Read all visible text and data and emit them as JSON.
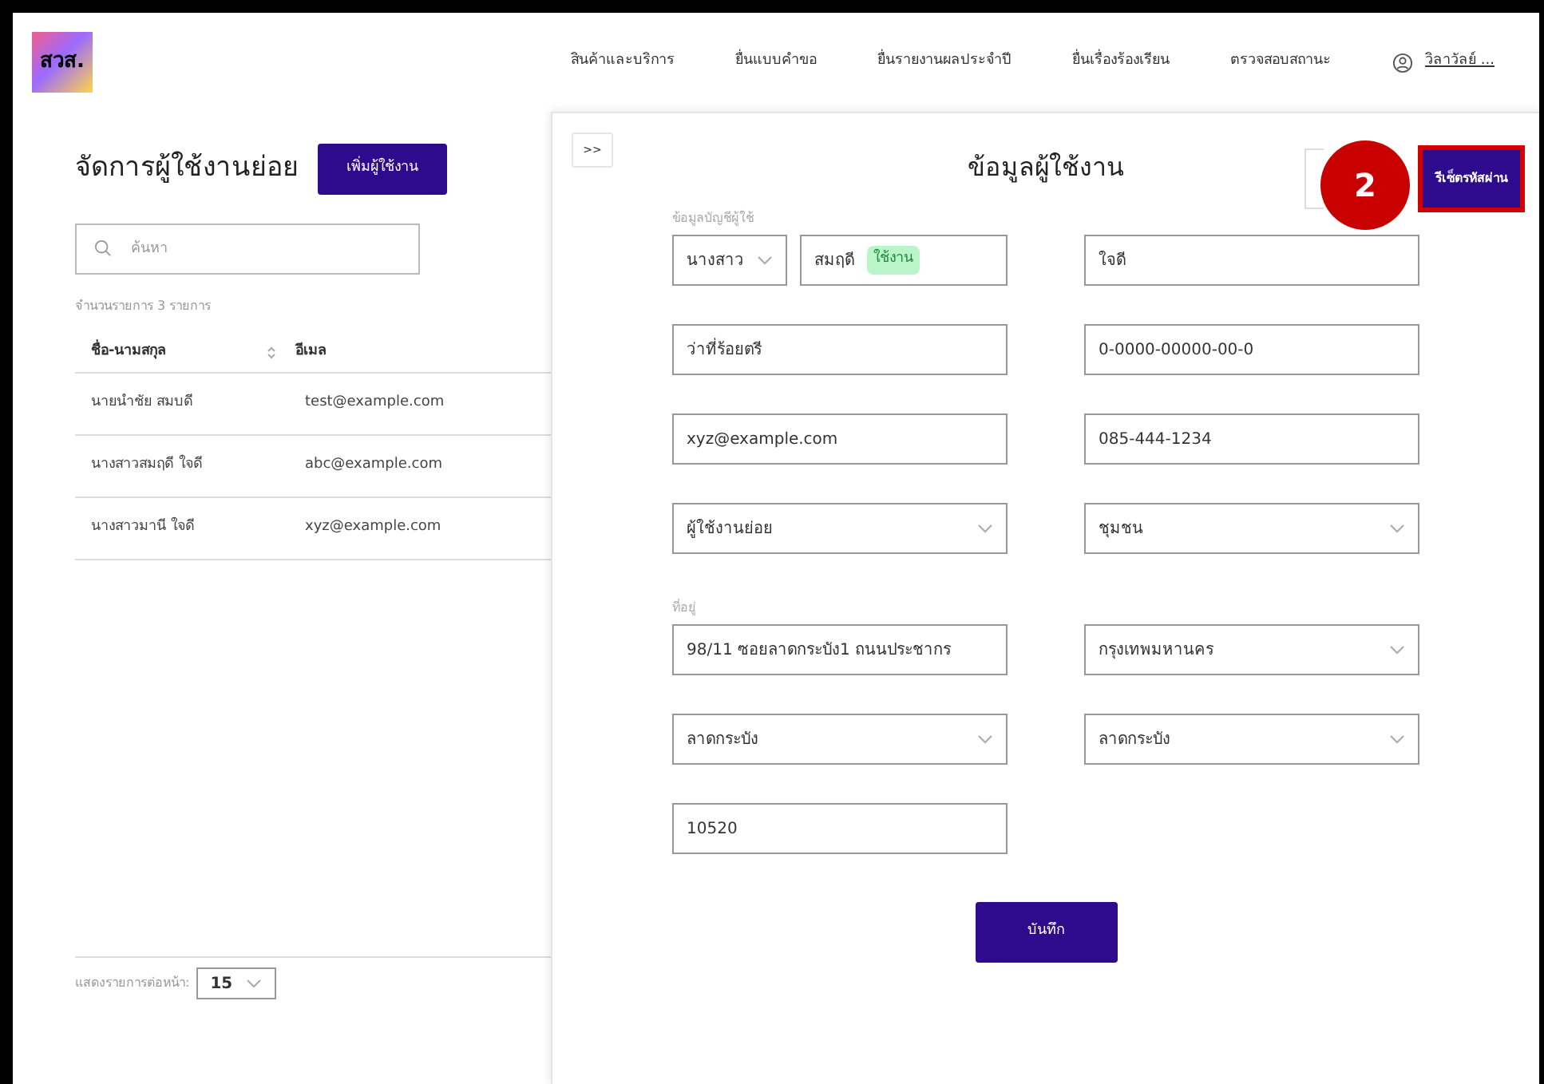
{
  "header": {
    "logo": "สวส.",
    "nav": [
      "สินค้าและบริการ",
      "ยื่นแบบคำขอ",
      "ยื่นรายงานผลประจำปี",
      "ยื่นเรื่องร้องเรียน",
      "ตรวจสอบสถานะ"
    ],
    "user": "วิลาวัลย์ ..."
  },
  "list_panel": {
    "title": "จัดการผู้ใช้งานย่อย",
    "add_button": "เพิ่มผู้ใช้งาน",
    "search": {
      "placeholder": "ค้นหา"
    },
    "count": "จำนวนรายการ 3 รายการ",
    "columns": [
      "ชื่อ-นามสกุล",
      "อีเมล"
    ],
    "rows": [
      {
        "name": "นายนำชัย สมบดี",
        "email": "test@example.com",
        "selected": false
      },
      {
        "name": "นางสาวสมฤดี ใจดี",
        "email": "abc@example.com",
        "selected": false
      },
      {
        "name": "นางสาวมานี ใจดี",
        "email": "xyz@example.com",
        "selected": false
      }
    ],
    "page_size_label": "แสดงรายการต่อหน้า:",
    "page_size": "15"
  },
  "detail_panel": {
    "collapse_button": ">>",
    "title": "ข้อมูลผู้ใช้งาน",
    "reset_button": "รีเซ็ตรหัสผ่าน",
    "annotation": "2",
    "sections": [
      {
        "label": "ข้อมูลบัญชีผู้ใช้",
        "fields": [
          {
            "kind": "prefix_name",
            "prefix": "นางสาว",
            "value": "สมฤดี",
            "badge": "ใช้งาน"
          },
          {
            "kind": "text",
            "value": "ใจดี"
          },
          {
            "kind": "text",
            "value": "ว่าที่ร้อยตรี"
          },
          {
            "kind": "text",
            "value": "0-0000-00000-00-0"
          },
          {
            "kind": "text",
            "value": "xyz@example.com"
          },
          {
            "kind": "text",
            "value": "085-444-1234"
          },
          {
            "kind": "select",
            "value": "ผู้ใช้งานย่อย"
          },
          {
            "kind": "select",
            "value": "ชุมชน"
          }
        ]
      },
      {
        "label": "ที่อยู่",
        "fields": [
          {
            "kind": "text",
            "value": "98/11 ซอยลาดกระบัง1 ถนนประชากร"
          },
          {
            "kind": "select",
            "value": "กรุงเทพมหานคร"
          },
          {
            "kind": "select",
            "value": "ลาดกระบัง"
          },
          {
            "kind": "select",
            "value": "ลาดกระบัง"
          },
          {
            "kind": "text",
            "value": "10520"
          }
        ]
      }
    ],
    "save_button": "บันทึก"
  }
}
